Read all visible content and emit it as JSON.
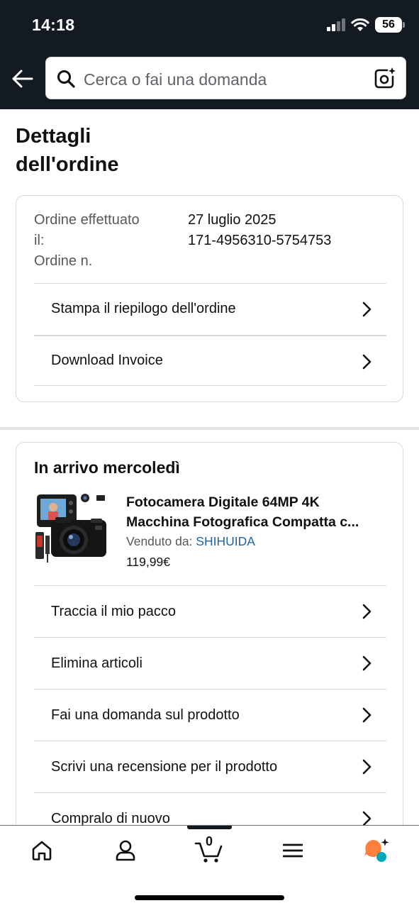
{
  "status_bar": {
    "time": "14:18",
    "battery": "56"
  },
  "header": {
    "back_icon": "arrow-left-icon",
    "search_placeholder": "Cerca o fai una domanda",
    "search_icon": "search-icon",
    "lens_icon": "camera-sparkle-icon",
    "bg_color": "#131a22"
  },
  "page": {
    "title_line1": "Dettagli",
    "title_line2": "dell'ordine"
  },
  "order_info": {
    "date_label_line1": "Ordine effettuato",
    "date_label_line2": "il:",
    "number_label": "Ordine n.",
    "date_value": "27 luglio 2025",
    "number_value": "171-4956310-5754753",
    "actions": [
      {
        "label": "Stampa il riepilogo dell'ordine"
      },
      {
        "label": "Download Invoice"
      }
    ]
  },
  "shipment": {
    "arrival": "In arrivo mercoledì",
    "product": {
      "title_line1": "Fotocamera Digitale 64MP 4K",
      "title_line2": "Macchina Fotografica Compatta c...",
      "seller_prefix": "Venduto da: ",
      "seller_name": "SHIHUIDA",
      "price": "119,99€"
    },
    "actions": [
      {
        "label": "Traccia il mio pacco"
      },
      {
        "label": "Elimina articoli"
      },
      {
        "label": "Fai una domanda sul prodotto"
      },
      {
        "label": "Scrivi una recensione per il prodotto"
      },
      {
        "label": "Compralo di nuovo"
      }
    ]
  },
  "bottom_nav": {
    "items": [
      "home-icon",
      "account-icon",
      "cart-icon",
      "menu-icon",
      "rufus-assistant-icon"
    ],
    "cart_count": "0",
    "accent_color": "#ff7f3f"
  },
  "colors": {
    "link": "#2162a1",
    "text": "#0f1111",
    "secondary_text": "#565959",
    "border": "#d5d9d9"
  }
}
